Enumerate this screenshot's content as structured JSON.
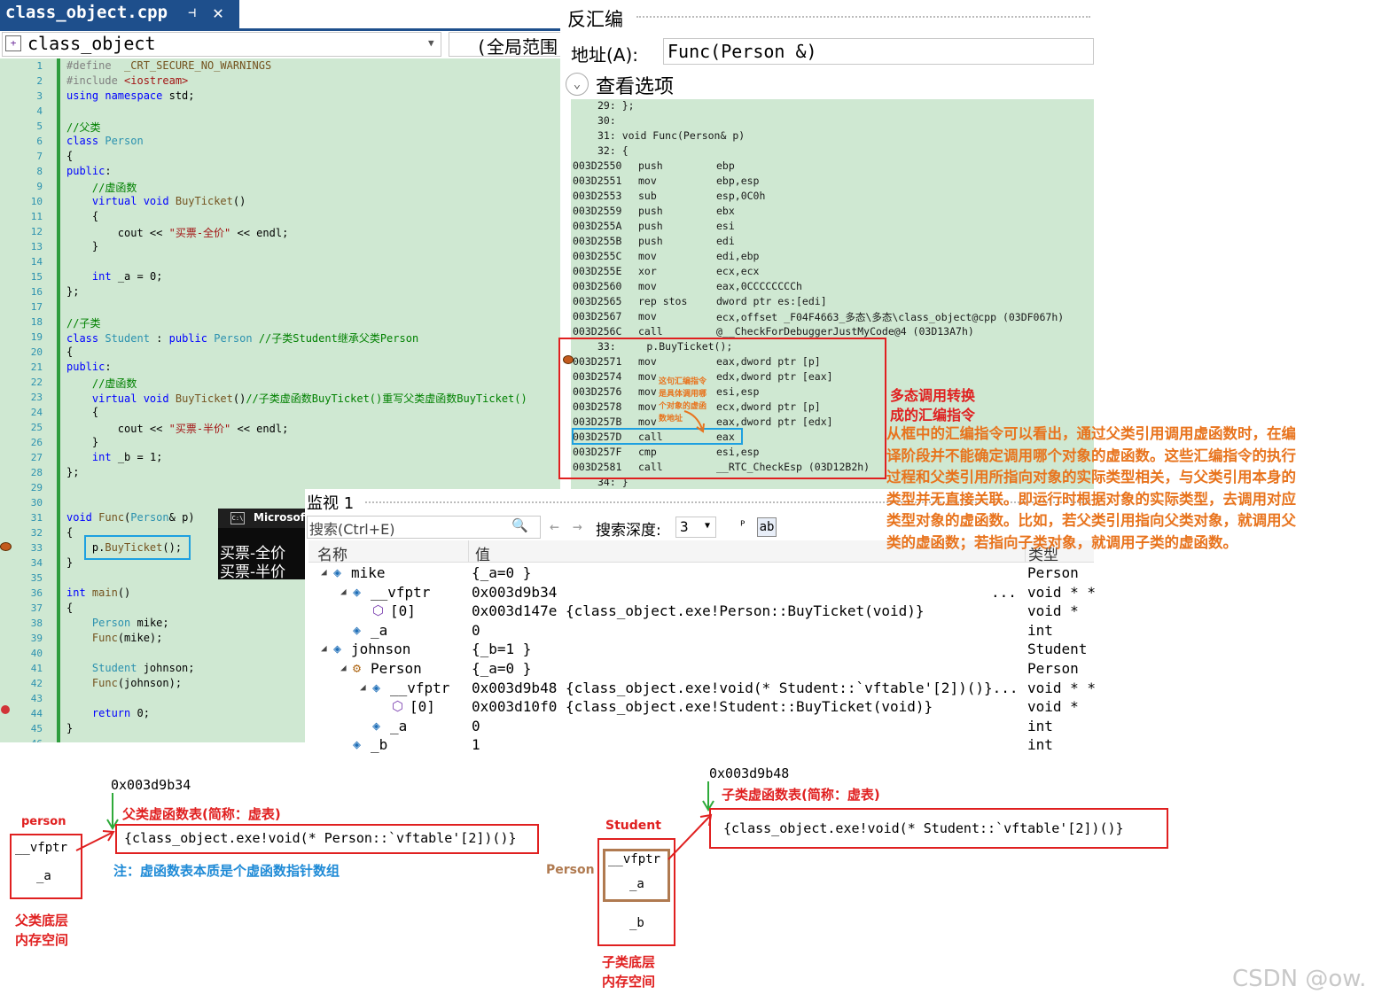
{
  "editor": {
    "tab_title": "class_object.cpp",
    "pin_icon": "⊣",
    "close_icon": "✕",
    "scope_class": "class_object",
    "scope_global": "(全局范围",
    "lines": [
      {
        "n": "1",
        "html": "<span class='pp'>#define  </span><span class='fn'>_CRT_SECURE_NO_WARNINGS</span>"
      },
      {
        "n": "2",
        "html": "<span class='pp'>#include </span><span class='st'>&lt;iostream&gt;</span>"
      },
      {
        "n": "3",
        "html": "<span class='kw'>using namespace</span> std;"
      },
      {
        "n": "4",
        "html": ""
      },
      {
        "n": "5",
        "html": "<span class='cm'>//父类</span>"
      },
      {
        "n": "6",
        "html": "<span class='kw'>class</span> <span class='ty'>Person</span>"
      },
      {
        "n": "7",
        "html": "{"
      },
      {
        "n": "8",
        "html": "<span class='kw'>public</span>:"
      },
      {
        "n": "9",
        "html": "    <span class='cm'>//虚函数</span>"
      },
      {
        "n": "10",
        "html": "    <span class='kw'>virtual void</span> <span class='fn'>BuyTicket</span>()"
      },
      {
        "n": "11",
        "html": "    {"
      },
      {
        "n": "12",
        "html": "        cout &lt;&lt; <span class='st'>\"买票-全价\"</span> &lt;&lt; endl;"
      },
      {
        "n": "13",
        "html": "    }"
      },
      {
        "n": "14",
        "html": ""
      },
      {
        "n": "15",
        "html": "    <span class='kw'>int</span> _a = 0;"
      },
      {
        "n": "16",
        "html": "};"
      },
      {
        "n": "17",
        "html": ""
      },
      {
        "n": "18",
        "html": "<span class='cm'>//子类</span>"
      },
      {
        "n": "19",
        "html": "<span class='kw'>class</span> <span class='ty'>Student</span> : <span class='kw'>public</span> <span class='ty'>Person</span> <span class='cm'>//子类Student继承父类Person</span>"
      },
      {
        "n": "20",
        "html": "{"
      },
      {
        "n": "21",
        "html": "<span class='kw'>public</span>:"
      },
      {
        "n": "22",
        "html": "    <span class='cm'>//虚函数</span>"
      },
      {
        "n": "23",
        "html": "    <span class='kw'>virtual void</span> <span class='fn'>BuyTicket</span>()<span class='cm'>//子类虚函数BuyTicket()重写父类虚函数BuyTicket()</span>"
      },
      {
        "n": "24",
        "html": "    {"
      },
      {
        "n": "25",
        "html": "        cout &lt;&lt; <span class='st'>\"买票-半价\"</span> &lt;&lt; endl;"
      },
      {
        "n": "26",
        "html": "    }"
      },
      {
        "n": "27",
        "html": "    <span class='kw'>int</span> _b = 1;"
      },
      {
        "n": "28",
        "html": "};"
      },
      {
        "n": "29",
        "html": ""
      },
      {
        "n": "30",
        "html": ""
      },
      {
        "n": "31",
        "html": "<span class='kw'>void</span> <span class='fn'>Func</span>(<span class='ty'>Person</span>&amp; p)"
      },
      {
        "n": "32",
        "html": "{"
      },
      {
        "n": "33",
        "html": "    p.<span class='fn'>BuyTicket</span>();"
      },
      {
        "n": "34",
        "html": "}"
      },
      {
        "n": "35",
        "html": ""
      },
      {
        "n": "36",
        "html": "<span class='kw'>int</span> <span class='fn'>main</span>()"
      },
      {
        "n": "37",
        "html": "{"
      },
      {
        "n": "38",
        "html": "    <span class='ty'>Person</span> mike;"
      },
      {
        "n": "39",
        "html": "    <span class='fn'>Func</span>(mike);"
      },
      {
        "n": "40",
        "html": ""
      },
      {
        "n": "41",
        "html": "    <span class='ty'>Student</span> johnson;"
      },
      {
        "n": "42",
        "html": "    <span class='fn'>Func</span>(johnson);"
      },
      {
        "n": "43",
        "html": ""
      },
      {
        "n": "44",
        "html": "    <span class='kw'>return</span> 0;"
      },
      {
        "n": "45",
        "html": "}"
      },
      {
        "n": "46",
        "html": ""
      }
    ]
  },
  "disassembly": {
    "title": "反汇编",
    "address_label": "地址(A):",
    "address_value": "Func(Person &)",
    "options_label": "查看选项",
    "source_lines": [
      "29: };",
      "30:",
      "31: void Func(Person& p)",
      "32: {"
    ],
    "rows": [
      {
        "a": "003D2550",
        "m": "push",
        "o": "ebp"
      },
      {
        "a": "003D2551",
        "m": "mov",
        "o": "ebp,esp"
      },
      {
        "a": "003D2553",
        "m": "sub",
        "o": "esp,0C0h"
      },
      {
        "a": "003D2559",
        "m": "push",
        "o": "ebx"
      },
      {
        "a": "003D255A",
        "m": "push",
        "o": "esi"
      },
      {
        "a": "003D255B",
        "m": "push",
        "o": "edi"
      },
      {
        "a": "003D255C",
        "m": "mov",
        "o": "edi,ebp"
      },
      {
        "a": "003D255E",
        "m": "xor",
        "o": "ecx,ecx"
      },
      {
        "a": "003D2560",
        "m": "mov",
        "o": "eax,0CCCCCCCCh"
      },
      {
        "a": "003D2565",
        "m": "rep stos",
        "o": "dword ptr es:[edi]"
      },
      {
        "a": "003D2567",
        "m": "mov",
        "o": "ecx,offset _F04F4663_多态\\多态\\class_object@cpp (03DF067h)"
      },
      {
        "a": "003D256C",
        "m": "call",
        "o": "@__CheckForDebuggerJustMyCode@4 (03D13A7h)"
      }
    ],
    "call_source": "33:     p.BuyTicket();",
    "call_rows": [
      {
        "a": "003D2571",
        "m": "mov",
        "o": "eax,dword ptr [p]"
      },
      {
        "a": "003D2574",
        "m": "mov",
        "o": "edx,dword ptr [eax]"
      },
      {
        "a": "003D2576",
        "m": "mov",
        "o": "esi,esp"
      },
      {
        "a": "003D2578",
        "m": "mov",
        "o": "ecx,dword ptr [p]"
      },
      {
        "a": "003D257B",
        "m": "mov",
        "o": "eax,dword ptr [edx]"
      },
      {
        "a": "003D257D",
        "m": "call",
        "o": "eax"
      },
      {
        "a": "003D257F",
        "m": "cmp",
        "o": "esi,esp"
      },
      {
        "a": "003D2581",
        "m": "call",
        "o": "__RTC_CheckEsp (03D12B2h)"
      }
    ],
    "end_line": "34: }",
    "inline_note": [
      "这句汇编指令",
      "是具体调用哪",
      "个对象的虚函",
      "数地址"
    ]
  },
  "watch": {
    "title": "监视 1",
    "search_placeholder": "搜索(Ctrl+E)",
    "search_icon": "🔍",
    "depth_label": "搜索深度:",
    "depth_value": "3",
    "col_name": "名称",
    "col_value": "值",
    "col_type": "类型",
    "rows": [
      {
        "indent": 0,
        "tri": "◢",
        "icon": "obj",
        "name": "mike",
        "value": "{_a=0 }",
        "type": "Person"
      },
      {
        "indent": 1,
        "tri": "◢",
        "icon": "obj",
        "name": "__vfptr",
        "value": "0x003d9b34",
        "type": "void * *",
        "more": "..."
      },
      {
        "indent": 2,
        "tri": "",
        "icon": "cube",
        "name": "[0]",
        "value": "0x003d147e {class_object.exe!Person::BuyTicket(void)}",
        "type": "void *"
      },
      {
        "indent": 1,
        "tri": "",
        "icon": "field",
        "name": "_a",
        "value": "0",
        "type": "int"
      },
      {
        "indent": 0,
        "tri": "◢",
        "icon": "obj",
        "name": "johnson",
        "value": "{_b=1 }",
        "type": "Student"
      },
      {
        "indent": 1,
        "tri": "◢",
        "icon": "base",
        "name": "Person",
        "value": "{_a=0 }",
        "type": "Person"
      },
      {
        "indent": 2,
        "tri": "◢",
        "icon": "obj",
        "name": "__vfptr",
        "value": "0x003d9b48 {class_object.exe!void(* Student::`vftable'[2])()}...",
        "type": "void * *"
      },
      {
        "indent": 3,
        "tri": "",
        "icon": "cube",
        "name": "[0]",
        "value": "0x003d10f0 {class_object.exe!Student::BuyTicket(void)}",
        "type": "void *"
      },
      {
        "indent": 2,
        "tri": "",
        "icon": "field",
        "name": "_a",
        "value": "0",
        "type": "int"
      },
      {
        "indent": 1,
        "tri": "",
        "icon": "field",
        "name": "_b",
        "value": "1",
        "type": "int"
      }
    ]
  },
  "console": {
    "title": "Microsof",
    "line1": "买票-全价",
    "line2": "买票-半价"
  },
  "annotations": {
    "asm_title_1": "多态调用转换",
    "asm_title_2": "成的汇编指令",
    "asm_explain": [
      "从框中的汇编指令可以看出，通过父类引用调用虚函数时，在编",
      "译阶段并不能确定调用哪个对象的虚函数。这些汇编指令的执行",
      "过程和父类引用所指向对象的实际类型相关，与父类引用本身的",
      "类型并无直接关联。即运行时根据对象的实际类型，去调用对应",
      "类型对象的虚函数。比如，若父类引用指向父类对象，就调用父",
      "类的虚函数；若指向子类对象，就调用子类的虚函数。"
    ],
    "p_addr": "0x003d9b34",
    "p_vtable_title": "父类虚函数表(简称：虚表)",
    "p_vtable_content": "{class_object.exe!void(* Person::`vftable'[2])()}",
    "p_label": "person",
    "p_vfptr": "__vfptr",
    "p_a": "_a",
    "p_mem_1": "父类底层",
    "p_mem_2": "内存空间",
    "note": "注：虚函数表本质是个虚函数指针数组",
    "s_addr": "0x003d9b48",
    "s_vtable_title": "子类虚函数表(简称：虚表)",
    "s_vtable_content": "{class_object.exe!void(* Student::`vftable'[2])()}",
    "s_label": "Student",
    "s_person": "Person",
    "s_vfptr": "__vfptr",
    "s_a": "_a",
    "s_b": "_b",
    "s_mem_1": "子类底层",
    "s_mem_2": "内存空间",
    "watermark": "CSDN @ow."
  }
}
